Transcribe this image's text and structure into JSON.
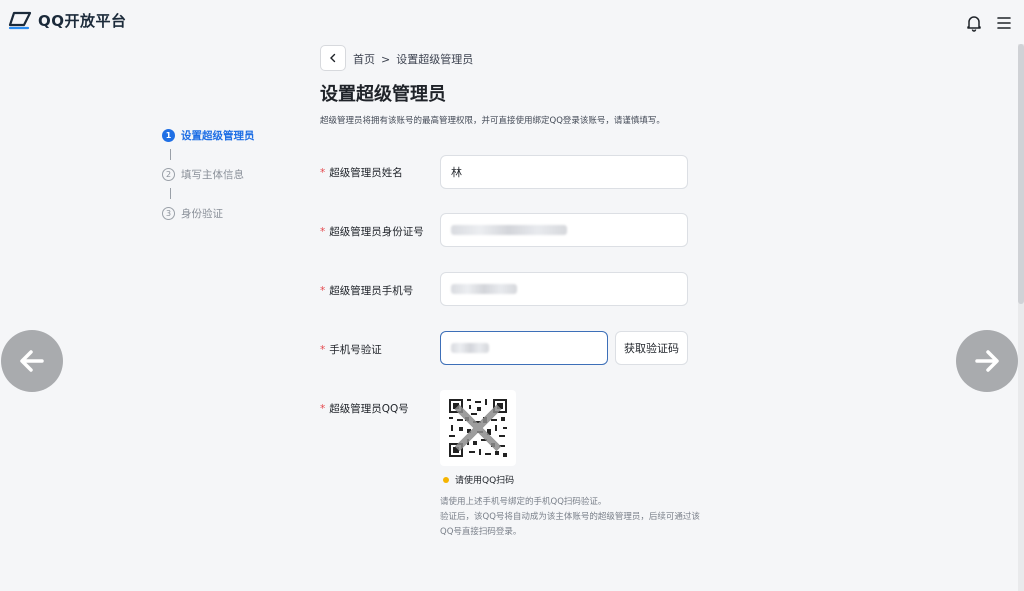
{
  "header": {
    "logo_text": "QQ开放平台",
    "icons": [
      "bell-icon",
      "menu-icon"
    ]
  },
  "breadcrumb": {
    "home": "首页",
    "separator": ">",
    "current": "设置超级管理员"
  },
  "page": {
    "title": "设置超级管理员",
    "description": "超级管理员将拥有该账号的最高管理权限，并可直接使用绑定QQ登录该账号，请谨慎填写。"
  },
  "steps": [
    {
      "num": "1",
      "label": "设置超级管理员",
      "state": "active"
    },
    {
      "num": "2",
      "label": "填写主体信息",
      "state": "inactive"
    },
    {
      "num": "3",
      "label": "身份验证",
      "state": "inactive"
    }
  ],
  "form": {
    "required_mark": "*",
    "name_label": "超级管理员姓名",
    "name_value": "林",
    "id_label": "超级管理员身份证号",
    "phone_label": "超级管理员手机号",
    "sms_label": "手机号验证",
    "sms_button": "获取验证码",
    "qq_label": "超级管理员QQ号"
  },
  "qr": {
    "status": "请使用QQ扫码",
    "help_line1": "请使用上述手机号绑定的手机QQ扫码验证。",
    "help_line2": "验证后，该QQ号将自动成为该主体账号的超级管理员，后续可通过该QQ号直接扫码登录。"
  },
  "colors": {
    "accent": "#1f6fe5",
    "required": "#e5484d",
    "status_dot": "#f5b400"
  }
}
